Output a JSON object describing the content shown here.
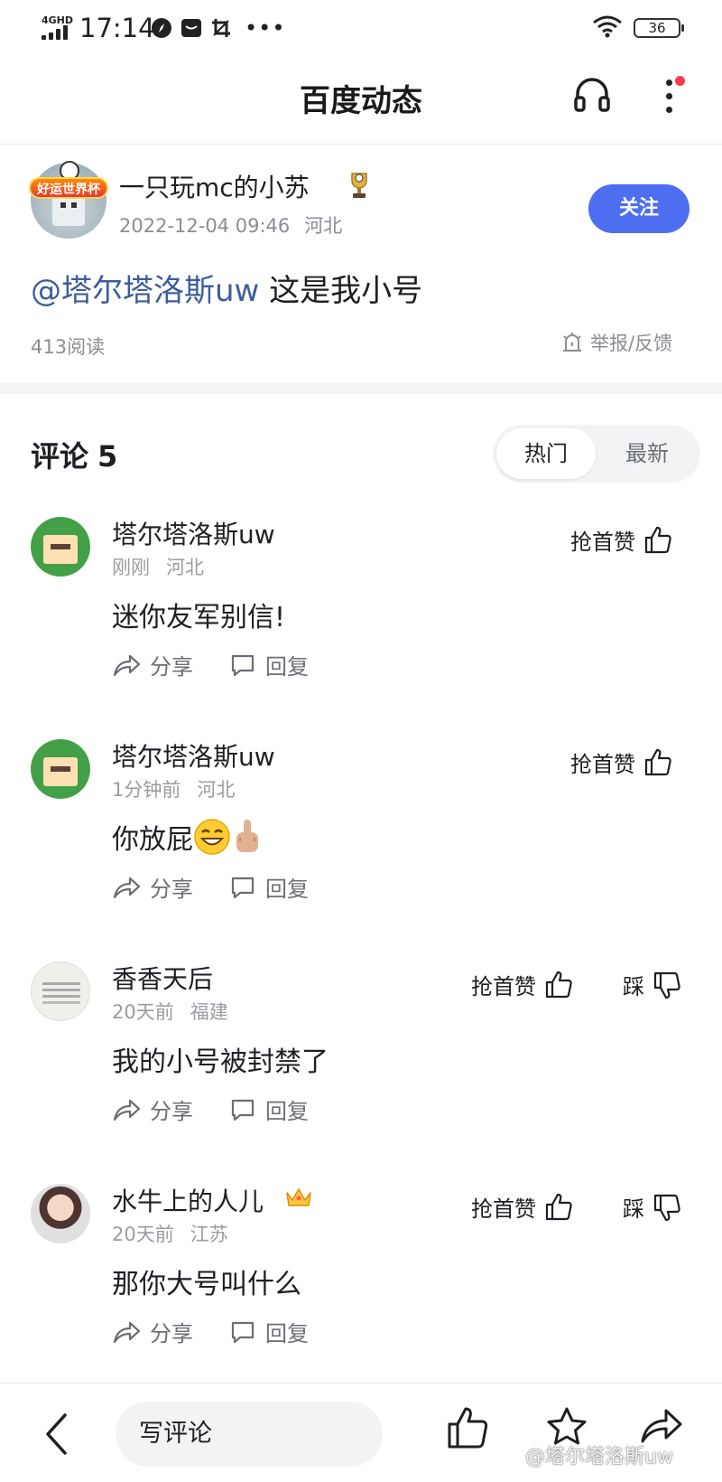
{
  "status_bar": {
    "network": "4GHD",
    "time": "17:14",
    "battery": "36"
  },
  "nav": {
    "title": "百度动态"
  },
  "post": {
    "author": "一只玩mc的小苏",
    "avatar_badge": "好运世界杯",
    "datetime": "2022-12-04 09:46",
    "location": "河北",
    "follow_label": "关注",
    "mention": "@塔尔塔洛斯uw",
    "text": " 这是我小号",
    "reads": "413阅读",
    "report_label": "举报/反馈"
  },
  "comments_header": {
    "label": "评论",
    "count": "5",
    "sort_hot": "热门",
    "sort_new": "最新"
  },
  "comments": [
    {
      "user": "塔尔塔洛斯uw",
      "time": "刚刚",
      "location": "河北",
      "text": "迷你友军别信!",
      "like_label": "抢首赞",
      "dislike_label": "",
      "share_label": "分享",
      "reply_label": "回复"
    },
    {
      "user": "塔尔塔洛斯uw",
      "time": "1分钟前",
      "location": "河北",
      "text": "你放屁",
      "like_label": "抢首赞",
      "dislike_label": "",
      "share_label": "分享",
      "reply_label": "回复"
    },
    {
      "user": "香香天后",
      "time": "20天前",
      "location": "福建",
      "text": "我的小号被封禁了",
      "like_label": "抢首赞",
      "dislike_label": "踩",
      "share_label": "分享",
      "reply_label": "回复"
    },
    {
      "user": "水牛上的人儿",
      "time": "20天前",
      "location": "江苏",
      "text": "那你大号叫什么",
      "like_label": "抢首赞",
      "dislike_label": "踩",
      "share_label": "分享",
      "reply_label": "回复"
    }
  ],
  "bottom_bar": {
    "write_placeholder": "写评论"
  },
  "watermark": "@塔尔塔洛斯uw",
  "colors": {
    "accent": "#4e6ef2",
    "mention": "#3c5d9c",
    "notification_dot": "#ff3b4a",
    "muted_text": "#8a8d93"
  }
}
